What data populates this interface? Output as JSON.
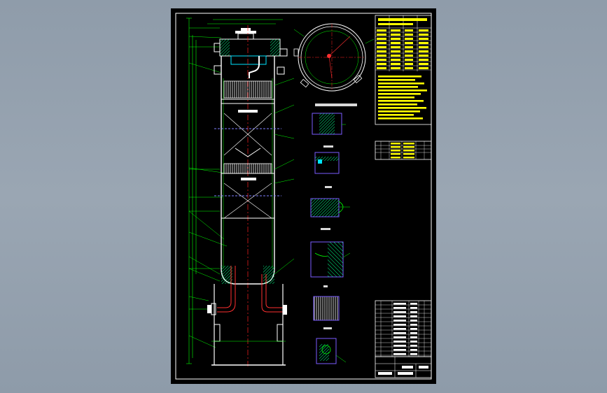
{
  "viewport": {
    "background": "#94a1ae"
  },
  "drawing": {
    "sheet_color": "#000000",
    "line_colors": {
      "outline": "#ffffff",
      "vessel": "#00ff00",
      "annotation": "#00ff00",
      "centerline": "#ff2020",
      "piping": "#ff3030",
      "section_fill": "#00ff88",
      "table_text": "#ffff00",
      "detail_box": "#7a5cff",
      "nozzle": "#00e5ff",
      "label": "#ff00ff"
    }
  }
}
